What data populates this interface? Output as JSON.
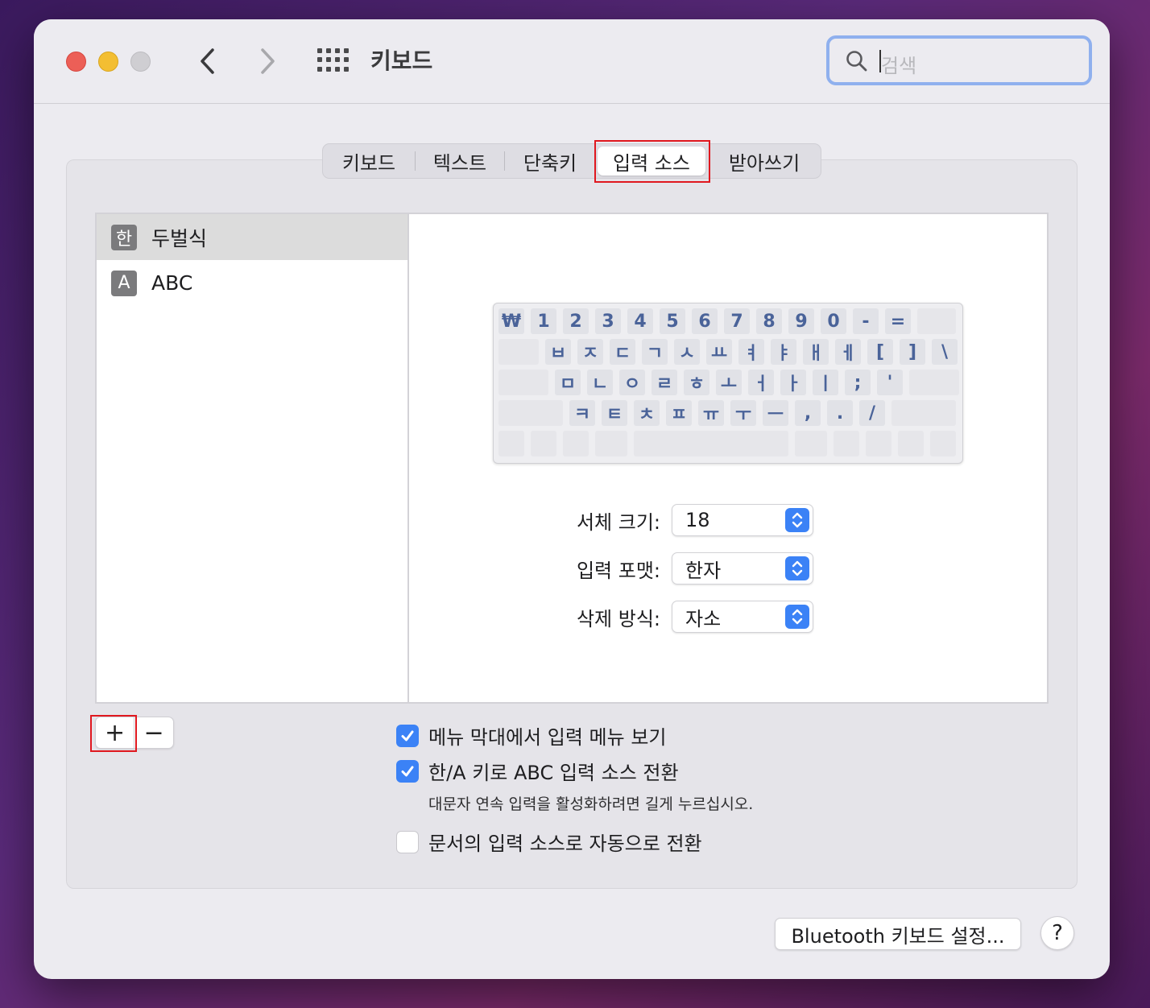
{
  "window": {
    "title": "키보드"
  },
  "search": {
    "placeholder": "검색"
  },
  "tabs": [
    {
      "label": "키보드"
    },
    {
      "label": "텍스트"
    },
    {
      "label": "단축키"
    },
    {
      "label": "입력 소스"
    },
    {
      "label": "받아쓰기"
    }
  ],
  "active_tab": "입력 소스",
  "sources": [
    {
      "icon_char": "한",
      "label": "두벌식",
      "selected": true
    },
    {
      "icon_char": "A",
      "label": "ABC",
      "selected": false
    }
  ],
  "keyboard_layout": {
    "row1": [
      "₩",
      "1",
      "2",
      "3",
      "4",
      "5",
      "6",
      "7",
      "8",
      "9",
      "0",
      "-",
      "="
    ],
    "row2": [
      "ㅂ",
      "ㅈ",
      "ㄷ",
      "ㄱ",
      "ㅅ",
      "ㅛ",
      "ㅕ",
      "ㅑ",
      "ㅐ",
      "ㅔ",
      "[",
      "]",
      "\\"
    ],
    "row3": [
      "ㅁ",
      "ㄴ",
      "ㅇ",
      "ㄹ",
      "ㅎ",
      "ㅗ",
      "ㅓ",
      "ㅏ",
      "ㅣ",
      ";",
      "'"
    ],
    "row4": [
      "ㅋ",
      "ㅌ",
      "ㅊ",
      "ㅍ",
      "ㅠ",
      "ㅜ",
      "ㅡ",
      ",",
      ".",
      "/"
    ]
  },
  "settings": {
    "font_size": {
      "label": "서체 크기:",
      "value": "18"
    },
    "input_format": {
      "label": "입력 포맷:",
      "value": "한자"
    },
    "delete_mode": {
      "label": "삭제 방식:",
      "value": "자소"
    }
  },
  "list_buttons": {
    "add": "+",
    "remove": "−"
  },
  "options": {
    "show_menu": {
      "label": "메뉴 막대에서 입력 메뉴 보기",
      "checked": true
    },
    "hanA_switch": {
      "label": "한/A 키로 ABC 입력 소스 전환",
      "checked": true
    },
    "hint": "대문자 연속 입력을 활성화하려면 길게 누르십시오.",
    "auto_switch": {
      "label": "문서의 입력 소스로 자동으로 전환",
      "checked": false
    }
  },
  "footer": {
    "bluetooth_button": "Bluetooth 키보드 설정...",
    "help": "?"
  },
  "colors": {
    "accent": "#3b82f6",
    "highlight_box": "#e0181f",
    "key_text": "#4a6399"
  }
}
